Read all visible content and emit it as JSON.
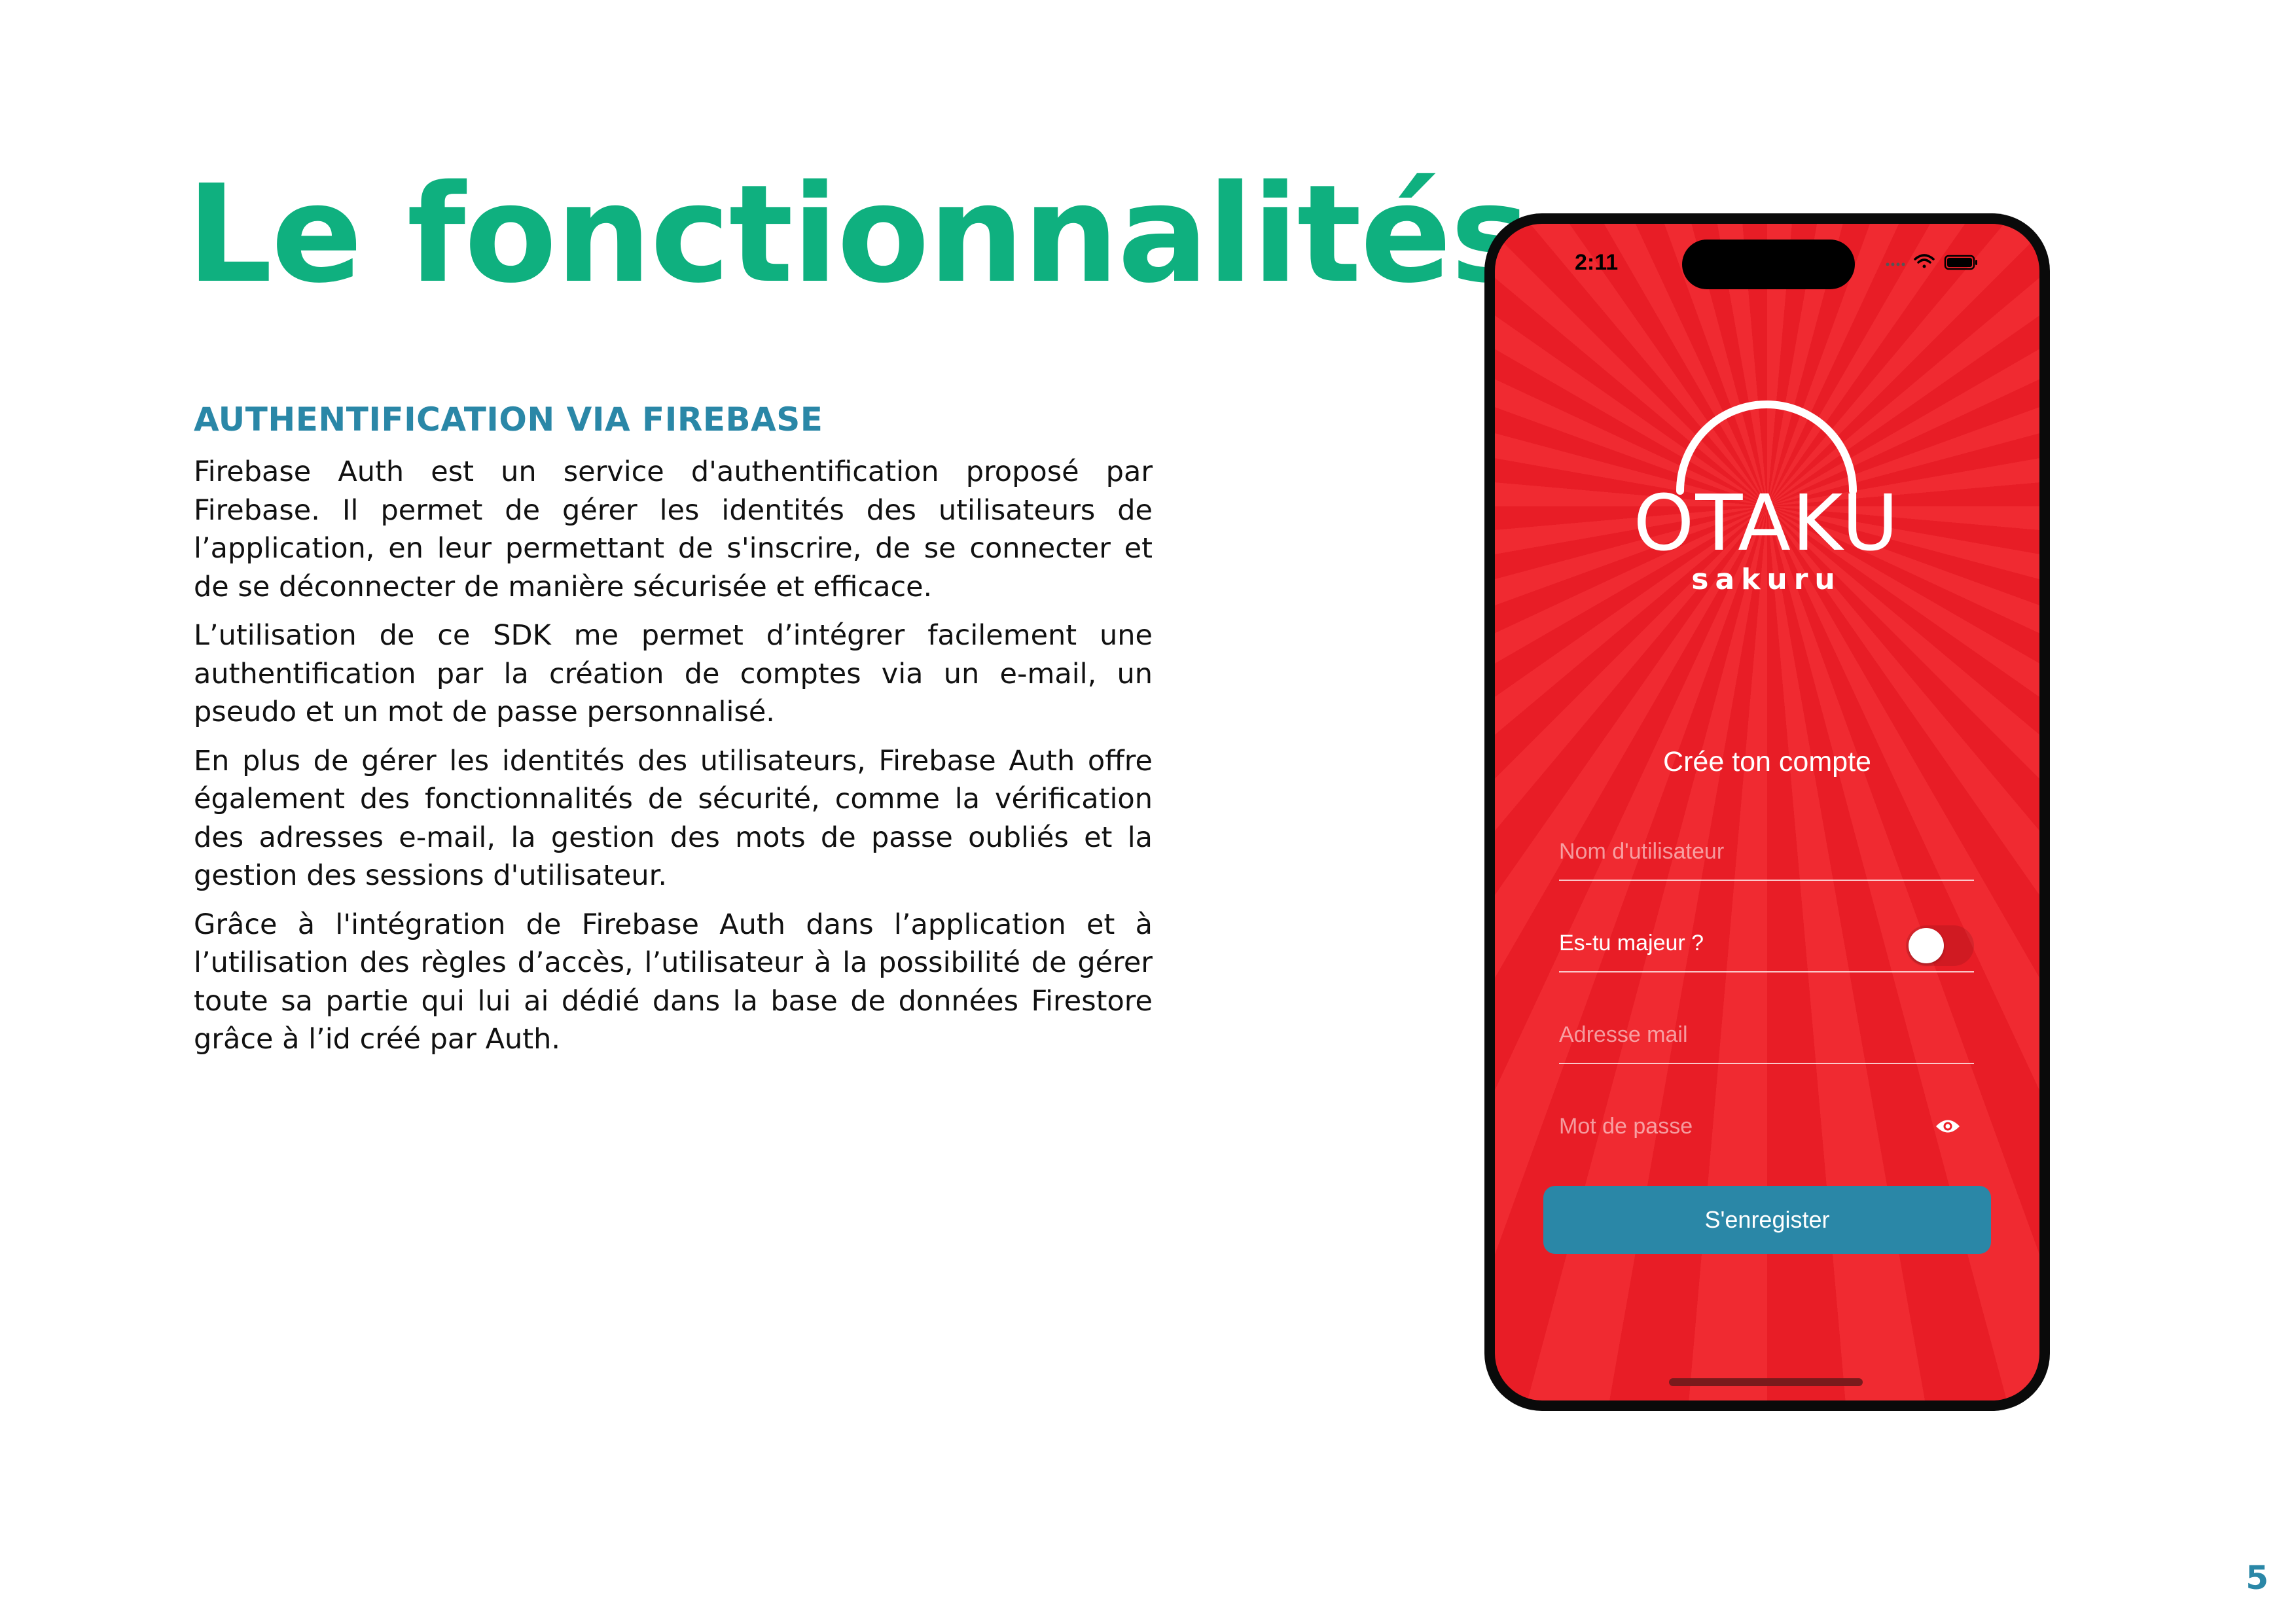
{
  "page": {
    "title": "Le fonctionnalités",
    "section_heading": "AUTHENTIFICATION VIA FIREBASE",
    "paragraphs": [
      "Firebase Auth est un service d'authentification proposé par Firebase. Il permet de gérer les identités des utilisateurs de l’application, en leur permettant de s'inscrire, de se connecter et de se déconnecter de manière sécurisée et efficace.",
      "L’utilisation de ce SDK me permet d’intégrer facilement une authentification par la création de comptes via un e-mail, un pseudo et un mot de passe personnalisé.",
      "En plus de gérer les identités des utilisateurs, Firebase Auth offre également des fonctionnalités de sécurité, comme la vérification des adresses e-mail, la gestion des mots de passe oubliés et la gestion des sessions d'utilisateur.",
      "Grâce à l'intégration de Firebase Auth dans l’application et à l’utilisation des règles d’accès, l’utilisateur à la possibilité de gérer toute sa partie qui lui ai dédié dans la base de données Firestore grâce à l’id créé par Auth."
    ],
    "page_number": "5"
  },
  "colors": {
    "title": "#0fb07f",
    "heading": "#2a87a7",
    "screen_red": "#ed1c24",
    "button": "#2a87a7"
  },
  "phone": {
    "status_bar": {
      "time": "2:11",
      "icons": [
        "signal-dots-icon",
        "wifi-icon",
        "battery-icon"
      ]
    },
    "logo": {
      "main": "OTAKU",
      "sub": "sakuru"
    },
    "form": {
      "title": "Crée ton compte",
      "username_placeholder": "Nom d'utilisateur",
      "adult_label": "Es-tu majeur ?",
      "adult_toggle_on": false,
      "email_placeholder": "Adresse mail",
      "password_placeholder": "Mot de passe",
      "password_icon": "eye-icon",
      "submit_label": "S'enregister"
    }
  }
}
